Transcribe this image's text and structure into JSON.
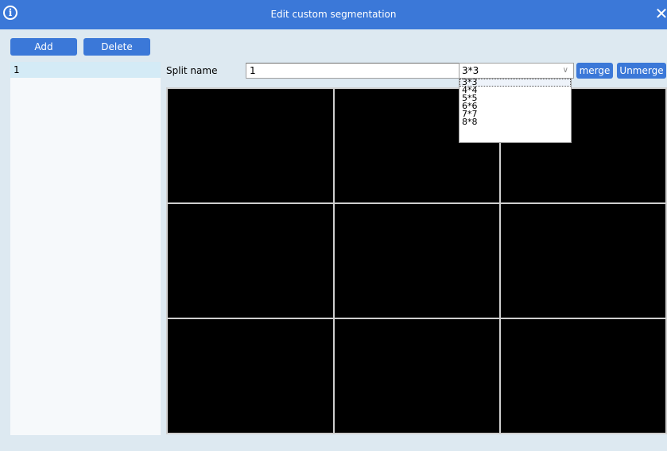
{
  "window": {
    "title": "Edit custom segmentation",
    "info_icon": "info-circle-icon",
    "close_icon": "close-icon",
    "close_glyph": "✕",
    "info_glyph": "i"
  },
  "toolbar": {
    "add_label": "Add",
    "delete_label": "Delete"
  },
  "segment_list": {
    "items": [
      {
        "label": "1"
      }
    ]
  },
  "editor": {
    "split_name_label": "Split name",
    "split_name_value": "1",
    "layout_select": {
      "value": "3*3",
      "options": [
        "3*3",
        "4*4",
        "5*5",
        "6*6",
        "7*7",
        "8*8"
      ]
    },
    "merge_label": "merge",
    "unmerge_label": "Unmerge"
  },
  "grid": {
    "rows": 3,
    "cols": 3
  },
  "colors": {
    "accent": "#3b78d8",
    "background": "#dde9f1",
    "grid_cell": "#000000",
    "selected_item": "#d4ebf6"
  }
}
